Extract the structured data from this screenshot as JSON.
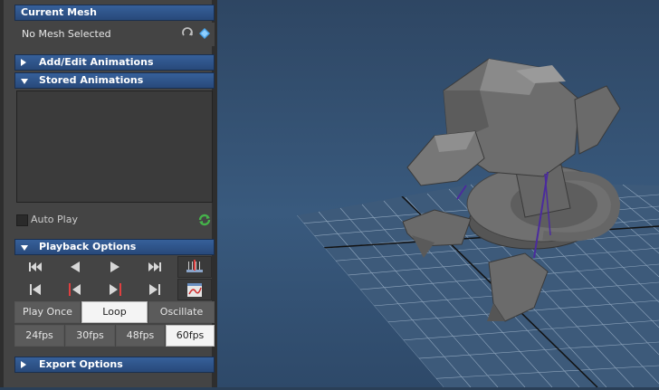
{
  "current_mesh": {
    "title": "Current Mesh",
    "value": "No Mesh Selected"
  },
  "sections": {
    "add_edit": "Add/Edit Animations",
    "stored": "Stored Animations",
    "playback": "Playback Options",
    "export": "Export Options"
  },
  "autoplay": {
    "label": "Auto Play",
    "checked": false
  },
  "playback_modes": [
    "Play Once",
    "Loop",
    "Oscillate"
  ],
  "active_mode": "Loop",
  "fps_options": [
    "24fps",
    "30fps",
    "48fps",
    "60fps"
  ],
  "active_fps": "60fps",
  "icons": {
    "transport_row1": [
      "skip-to-start-icon",
      "step-back-icon",
      "play-icon",
      "skip-to-end-icon"
    ],
    "transport_row2": [
      "first-frame-icon",
      "prev-key-icon",
      "next-key-icon",
      "last-frame-icon"
    ],
    "side": [
      "timeline-icon",
      "graph-editor-icon"
    ]
  },
  "colors": {
    "header": "#2f5589",
    "accent_green": "#45b24a",
    "viewport": "#395a7e"
  }
}
